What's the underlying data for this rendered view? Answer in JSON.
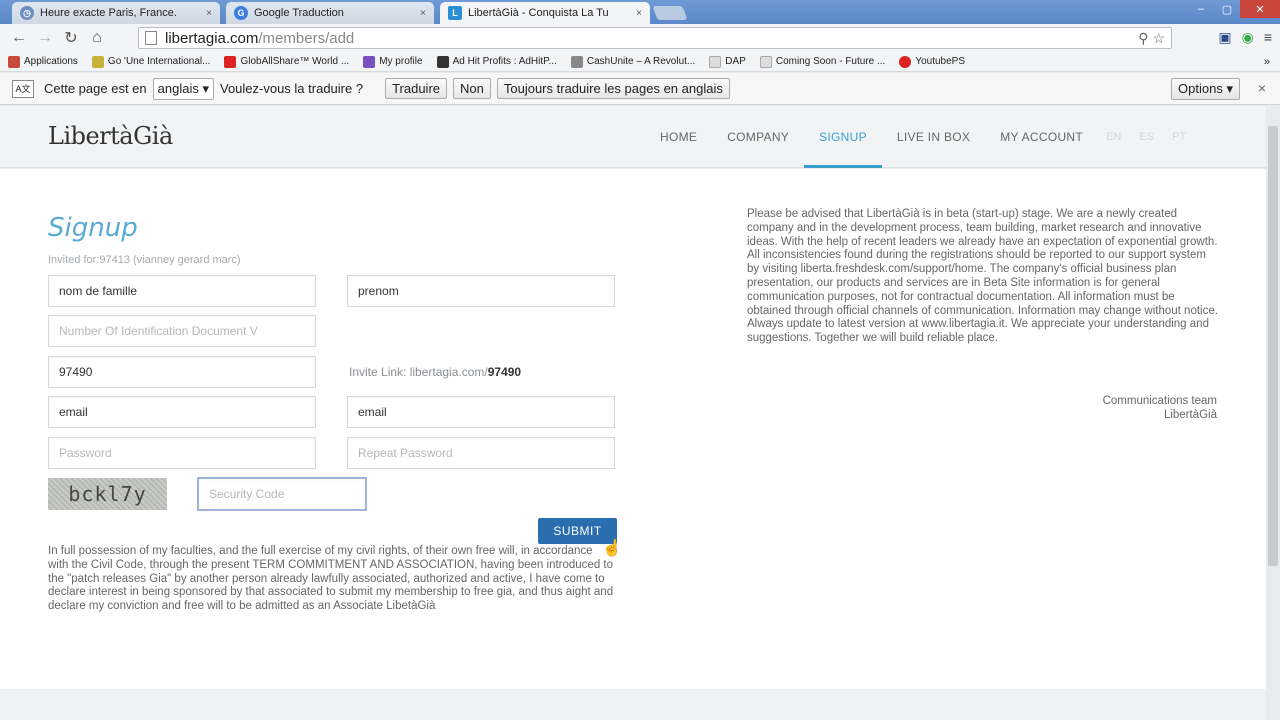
{
  "browser": {
    "tabs": [
      {
        "title": "Heure exacte Paris, France.",
        "close": "×",
        "icon_color": "#6c8ebf"
      },
      {
        "title": "Google Traduction",
        "close": "×",
        "icon_color": "#3d7de0"
      },
      {
        "title": "LibertàGià - Conquista La Tu",
        "close": "×",
        "icon_color": "#2a8fd4",
        "active": true
      }
    ],
    "window_controls": {
      "minimize": "–",
      "maximize": "▢",
      "close": "✕"
    },
    "nav": {
      "back": "←",
      "forward": "→",
      "reload": "↻",
      "home": "⌂"
    },
    "url": {
      "host": "libertagia.com",
      "path": "/members/add"
    },
    "bookmarks": [
      {
        "label": "Applications",
        "color": "#c94a3a"
      },
      {
        "label": "Go  'Une International...",
        "color": "#c8b23a"
      },
      {
        "label": "GlobAllShare™ World ...",
        "color": "#d22"
      },
      {
        "label": "My profile",
        "color": "#7a4fc0"
      },
      {
        "label": "Ad Hit Profits : AdHitP...",
        "color": "#333"
      },
      {
        "label": "CashUnite – A Revolut...",
        "color": "#888"
      },
      {
        "label": "DAP",
        "color": "#aaa"
      },
      {
        "label": "Coming Soon - Future ...",
        "color": "#aaa"
      },
      {
        "label": "YoutubePS",
        "color": "#d22"
      }
    ],
    "bookmarks_more": "»",
    "translate": {
      "prefix": "Cette page est en",
      "language": "anglais ▾",
      "question": "Voulez-vous la traduire ?",
      "translate_btn": "Traduire",
      "no_btn": "Non",
      "always_btn": "Toujours traduire les pages en anglais",
      "options_btn": "Options ▾",
      "close": "×"
    }
  },
  "site": {
    "logo": "LibertàGià",
    "nav": [
      {
        "label": "HOME"
      },
      {
        "label": "COMPANY"
      },
      {
        "label": "SIGNUP",
        "active": true
      },
      {
        "label": "LIVE IN BOX"
      },
      {
        "label": "MY ACCOUNT"
      }
    ],
    "languages": [
      "EN",
      "ES",
      "PT"
    ],
    "accent": "#3a9fcf"
  },
  "form": {
    "title": "Signup",
    "invited": "Invited for:97413 (vianney gerard marc)",
    "last_name": "nom de famille",
    "first_name": "prenom",
    "id_document_placeholder": "Number Of Identification Document V",
    "sponsor": "97490",
    "invite_link_prefix": "Invite Link: libertagia.com/",
    "invite_link_code": "97490",
    "email": "email",
    "email_repeat": "email",
    "password_placeholder": "Password",
    "repeat_password_placeholder": "Repeat Password",
    "captcha": "bckl7y",
    "security_code_placeholder": "Security Code",
    "submit": "SUBMIT",
    "terms": "In full possession of my faculties, and the full exercise of my civil rights, of their own free will, in accordance with the Civil Code, through the present TERM COMMITMENT AND ASSOCIATION, having been introduced to the \"patch releases Gia\" by another person already lawfully associated, authorized and active, I have come to declare interest in being sponsored by that associated to submit my membership to free gia, and thus aight and declare my conviction and free will to be admitted as an Associate LibetàGià"
  },
  "notice": {
    "text": "Please be advised that LibertàGià is in beta (start-up) stage. We are a newly created company and in the development process, team building, market research and innovative ideas. With the help of recent leaders we already have an expectation of exponential growth. All inconsistencies found during the registrations should be reported to our support system by visiting liberta.freshdesk.com/support/home. The company's official business plan presentation, our products and services are in Beta Site information is for general communication purposes, not for contractual documentation. All information must be obtained through official channels of communication. Information may change without notice. Always update to latest version at www.libertagia.it. We appreciate your understanding and suggestions. Together we will build reliable place.",
    "signature_line1": "Communications team",
    "signature_line2": "LibertàGià"
  }
}
